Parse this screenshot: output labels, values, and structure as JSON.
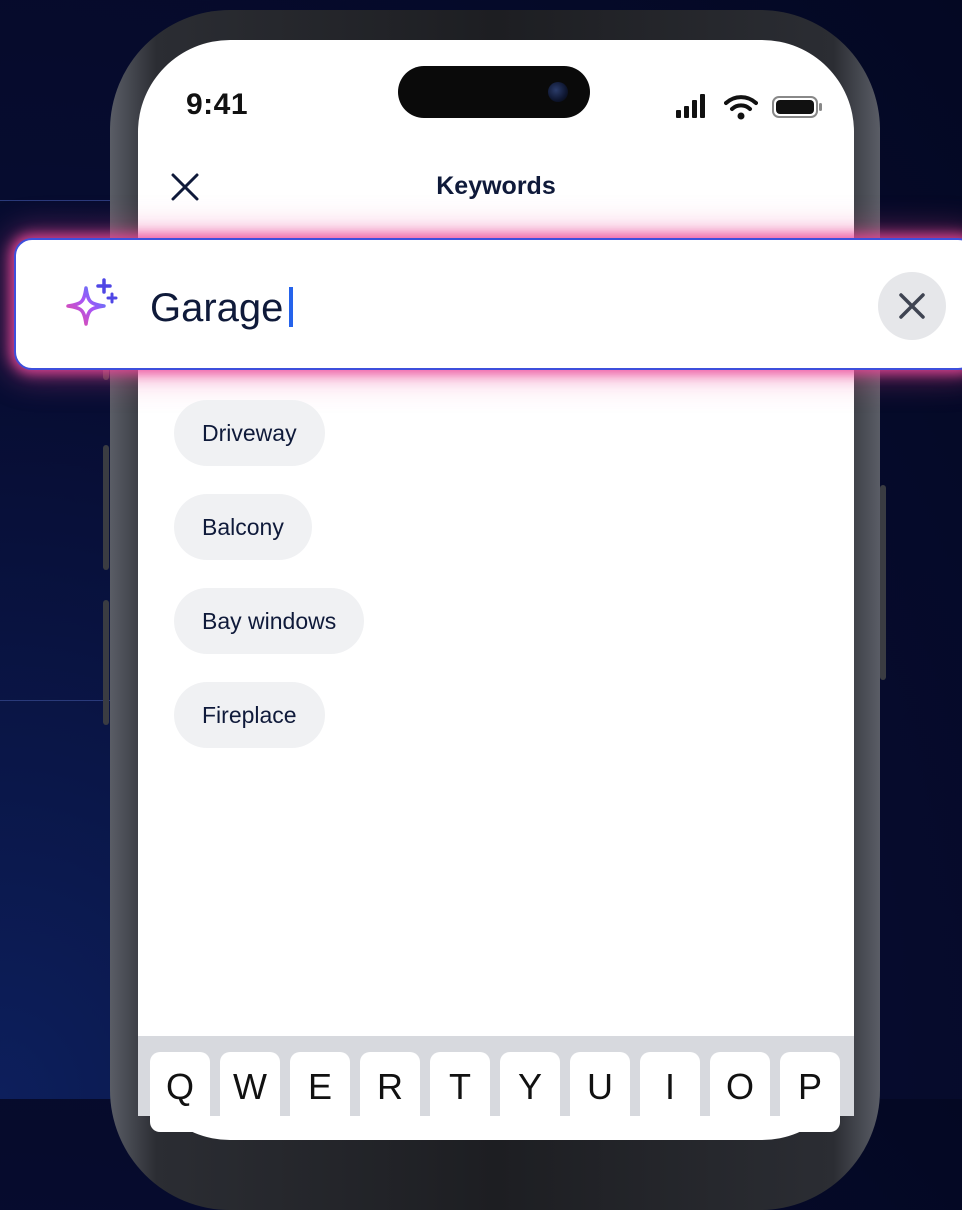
{
  "status_bar": {
    "time": "9:41",
    "icons": [
      "signal-icon",
      "wifi-icon",
      "battery-icon"
    ]
  },
  "header": {
    "title": "Keywords",
    "close_icon": "close-icon"
  },
  "search": {
    "value": "Garage",
    "icon": "sparkle-icon",
    "clear_icon": "clear-icon"
  },
  "suggestions": [
    {
      "label": "Driveway"
    },
    {
      "label": "Balcony"
    },
    {
      "label": "Bay windows"
    },
    {
      "label": "Fireplace"
    }
  ],
  "keyboard": {
    "row1": [
      "Q",
      "W",
      "E",
      "R",
      "T",
      "Y",
      "U",
      "I",
      "O",
      "P"
    ]
  },
  "colors": {
    "background": "#070d33",
    "accent": "#2563eb",
    "glow": "#ec4899",
    "text": "#0f1a3a",
    "chip": "#f0f1f3"
  }
}
